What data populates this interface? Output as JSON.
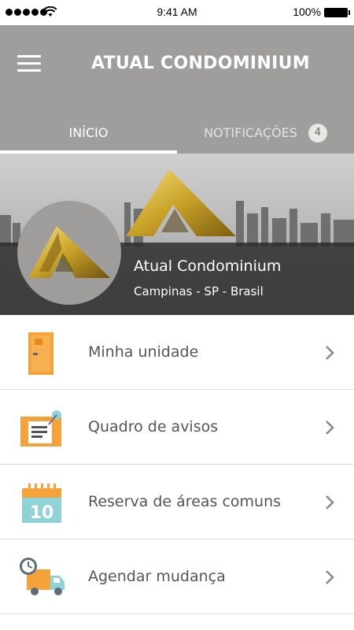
{
  "status_bar": {
    "time": "9:41 AM",
    "battery": "100%"
  },
  "header": {
    "title": "ATUAL CONDOMINIUM"
  },
  "tabs": [
    {
      "label": "INÍCIO",
      "active": true
    },
    {
      "label": "NOTIFICAÇÕES",
      "badge": "4",
      "active": false
    }
  ],
  "banner": {
    "name": "Atual Condominium",
    "location": "Campinas - SP - Brasil"
  },
  "menu": [
    {
      "label": "Minha unidade",
      "icon": "door-icon"
    },
    {
      "label": "Quadro de avisos",
      "icon": "notice-board-icon"
    },
    {
      "label": "Reserva de áreas comuns",
      "icon": "calendar-icon"
    },
    {
      "label": "Agendar mudança",
      "icon": "moving-truck-clock-icon"
    }
  ],
  "calendar_icon_day": "10",
  "colors": {
    "header_bg": "#a09e9c",
    "accent_orange": "#f5a23a",
    "accent_teal": "#8fd3d9",
    "gold": "#c9a227"
  }
}
